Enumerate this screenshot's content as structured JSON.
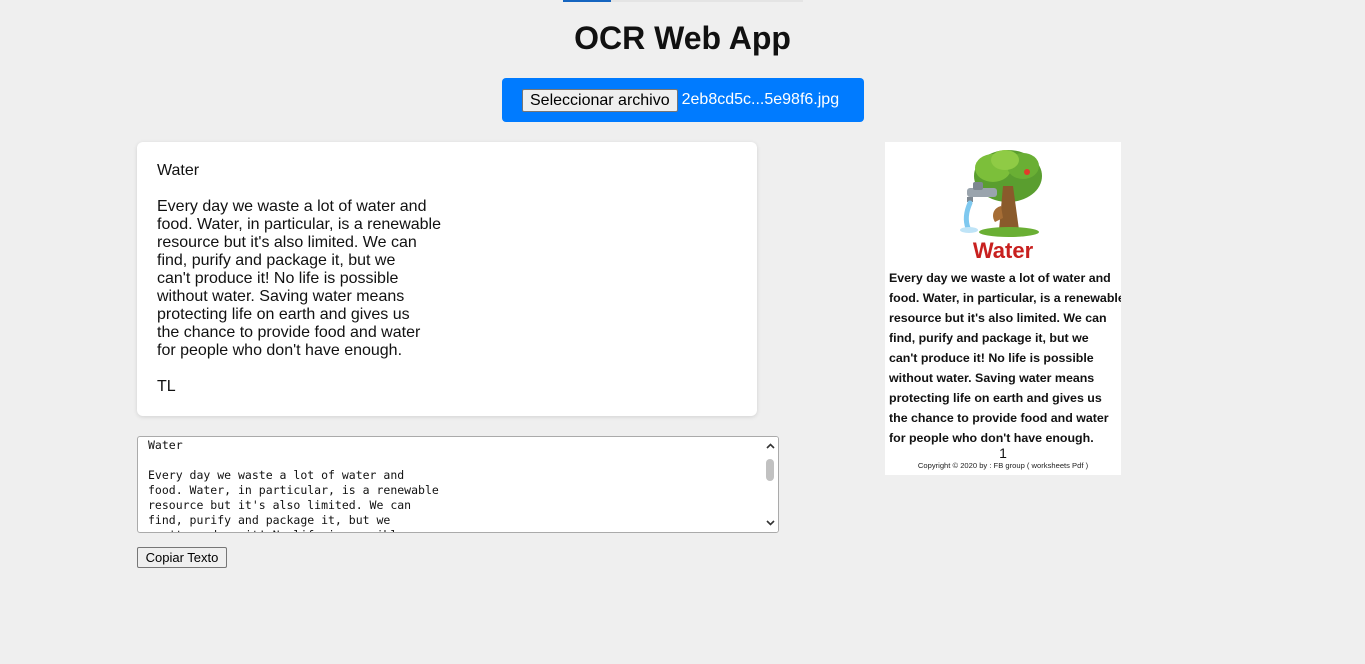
{
  "page": {
    "title": "OCR Web App"
  },
  "upload": {
    "button_label": "Seleccionar archivo",
    "file_name": "2eb8cd5c...5e98f6.jpg",
    "background_color": "#007bff"
  },
  "result": {
    "text": "Water\n\nEvery day we waste a lot of water and\nfood. Water, in particular, is a renewable\nresource but it's also limited. We can\nfind, purify and package it, but we\ncan't produce it! No life is possible\nwithout water. Saving water means\nprotecting life on earth and gives us\nthe chance to provide food and water\nfor people who don't have enough.\n\nTL"
  },
  "textarea": {
    "value": "Water\n\nEvery day we waste a lot of water and\nfood. Water, in particular, is a renewable\nresource but it's also limited. We can\nfind, purify and package it, but we\ncan't produce it! No life is possible"
  },
  "copy_button": {
    "label": "Copiar Texto"
  },
  "preview": {
    "heading": "Water",
    "heading_color": "#c8201f",
    "body": "Every day we waste a lot of water and\nfood. Water, in particular, is a renewable\nresource but it's also limited. We can\nfind, purify and package it, but we\ncan't produce it! No life is possible\nwithout water. Saving water means\nprotecting life on earth and gives us\nthe chance to provide food and water\nfor people who don't have enough.",
    "page_number": "1",
    "copyright": "Copyright © 2020   by : FB group ( worksheets Pdf )"
  }
}
